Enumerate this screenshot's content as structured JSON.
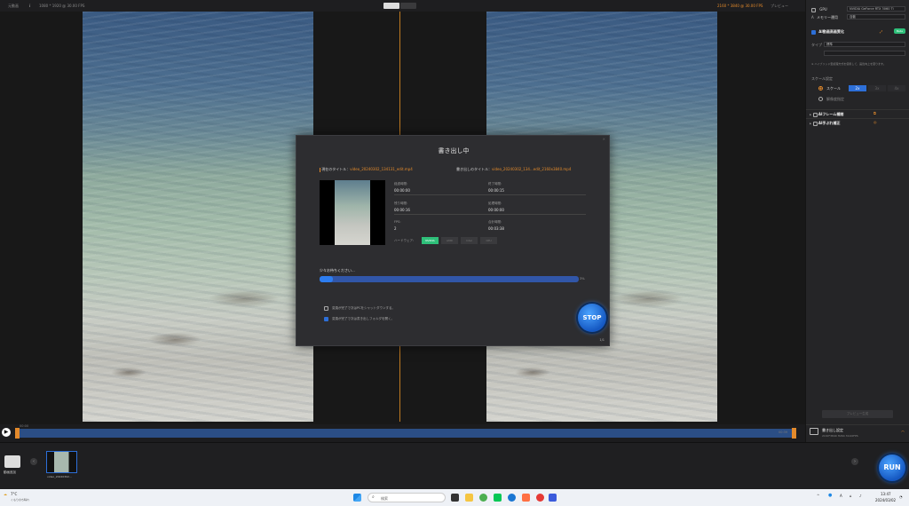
{
  "topbar": {
    "tab_label": "元動画",
    "left_resolution": "1080 * 1920 @ 30.00 FPS",
    "right_resolution": "2160 * 3840 @ 30.00 FPS",
    "right_tab": "プレビュー"
  },
  "timeline": {
    "time_start": "00:00",
    "time_end": "00:39"
  },
  "sidebar": {
    "gpu_label": "GPU",
    "gpu_value": "NVIDIA GeForce RTX 3060 Ti",
    "memory_label": "メモリー運用",
    "memory_value": "自動",
    "enhance_label": "AI動画高画質化",
    "enhance_badge": "Beta",
    "type_label": "タイプ",
    "type_value": "標準",
    "note": "※ ハイブリッド型処理方式を使用して、画質向上を図ります。",
    "scale_label": "スケール設定",
    "scale_option": "スケール",
    "scale_values": [
      "2x",
      "3x",
      "4x"
    ],
    "custom_res": "解像度指定",
    "frame_interp": "AIフレーム補間",
    "stabilize": "AI手ぶれ補正",
    "disabled_button": "プレビュー生成",
    "output_title": "書き出し設定",
    "output_detail": "2160*3840  H264  30.00FPS"
  },
  "dialog": {
    "title": "書き出し中",
    "source_label": "現在のタイトル：",
    "source_file": "video_20240302_134131_edit.mp4",
    "output_label": "書き出しのタイトル：",
    "output_file": "video_20240302_134...edit_2160x3840.mp4",
    "elapsed_label": "経過時間:",
    "elapsed_value": "00:00:00",
    "remaining_label": "残り時間:",
    "remaining_value": "00:00:16",
    "fps_label": "FPS:",
    "fps_value": "2",
    "end_label": "終了時間:",
    "end_value": "00:00:15",
    "processed_label": "処理時間:",
    "processed_value": "00:00:00",
    "total_label": "合計時間:",
    "total_value": "00:03:38",
    "hw_label": "ハードウェア:",
    "hw_options": [
      "NVIDIA",
      "AMD",
      "Intel",
      "CPU"
    ],
    "wait_text": "少々お待ちください...",
    "progress_percent": "3%",
    "progress_fraction": 0.05,
    "option1": "変換が完了で次はPCをシャットダウンする。",
    "option2": "変換が完了で次は書き出しフォルダを開く。",
    "stop_label": "STOP",
    "page_counter": "1/1"
  },
  "mediabar": {
    "add_label": "動画追加",
    "thumb_label": "video_20240302...",
    "run_label": "RUN"
  },
  "taskbar": {
    "weather_temp": "7°C",
    "weather_desc": "くもりのち晴れ",
    "search_placeholder": "検索",
    "ime": "A",
    "time": "13:47",
    "date": "2024/03/02"
  },
  "colors": {
    "accent": "#2d6fd8",
    "orange": "#e38a2b",
    "green": "#2fc07a"
  }
}
